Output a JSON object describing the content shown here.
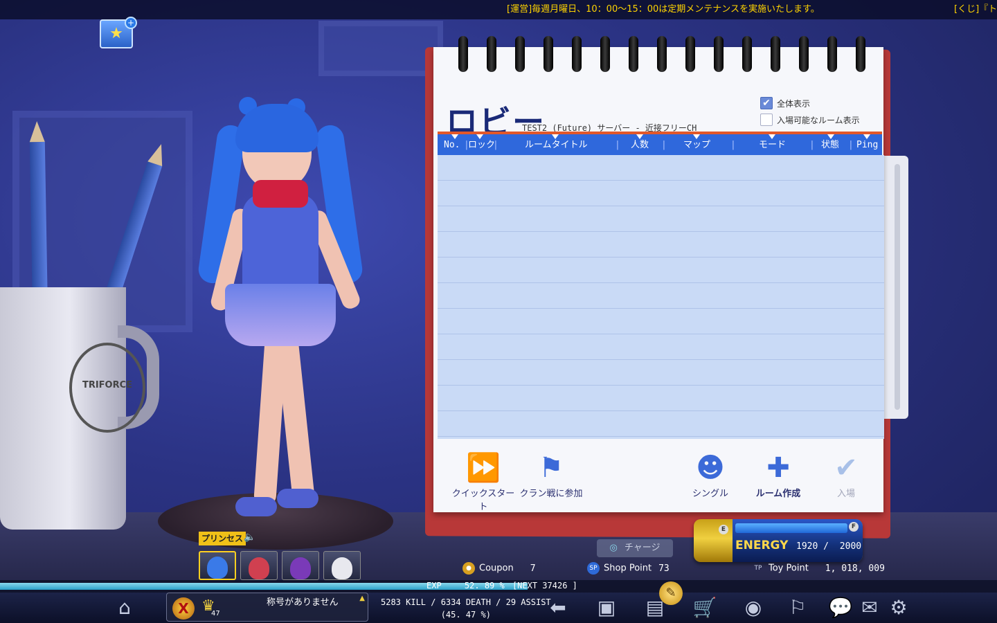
{
  "ticker": {
    "message": "[運営]毎週月曜日、10：00〜15：00は定期メンテナンスを実施いたします。",
    "message2": "[くじ]『ト"
  },
  "lobby": {
    "title": "ロビー",
    "server": "TEST2 (Future) サーバー -  近接フリーCH",
    "show_all_label": "全体表示",
    "show_all_checked": true,
    "show_joinable_label": "入場可能なルーム表示",
    "show_joinable_checked": false,
    "columns": [
      "No.",
      "ロック",
      "ルームタイトル",
      "人数",
      "マップ",
      "モード",
      "状態",
      "Ping"
    ],
    "rooms": [],
    "actions": [
      {
        "label": "クイックスタート",
        "icon": "fast-forward-icon"
      },
      {
        "label": "クラン戦に参加",
        "icon": "clan-flag-icon"
      },
      {
        "label": "シングル",
        "icon": "ninja-icon"
      },
      {
        "label": "ルーム作成",
        "icon": "plus-icon"
      },
      {
        "label": "入場",
        "icon": "check-icon"
      }
    ]
  },
  "energy": {
    "label": "ENERGY",
    "current": "1920",
    "sep": " / ",
    "max": "2000"
  },
  "charge_label": "チャージ",
  "points": {
    "coupon_label": "Coupon",
    "coupon_value": "7",
    "shop_badge": "SP",
    "shop_label": "Shop Point",
    "shop_value": "73",
    "toy_badge": "TP",
    "toy_label": "Toy Point",
    "toy_value": "1, 018, 009"
  },
  "character": {
    "name": "プリンセス",
    "slots": [
      "princess",
      "ninja",
      "purple-hair",
      "white-hair"
    ]
  },
  "exp": {
    "label": "EXP",
    "percent_text": "52. 89 %",
    "percent": 52.89,
    "next": "[NEXT  37426 ]"
  },
  "player": {
    "rank_level": "47",
    "title": "称号がありません",
    "stats": "5283 KILL / 6334 DEATH / 29 ASSIST",
    "ratio": "(45. 47 %)"
  },
  "colors": {
    "accent": "#2f68dc",
    "ticker": "#ffd400",
    "header_line": "#e2582a",
    "notebook_stand": "#b83838"
  }
}
